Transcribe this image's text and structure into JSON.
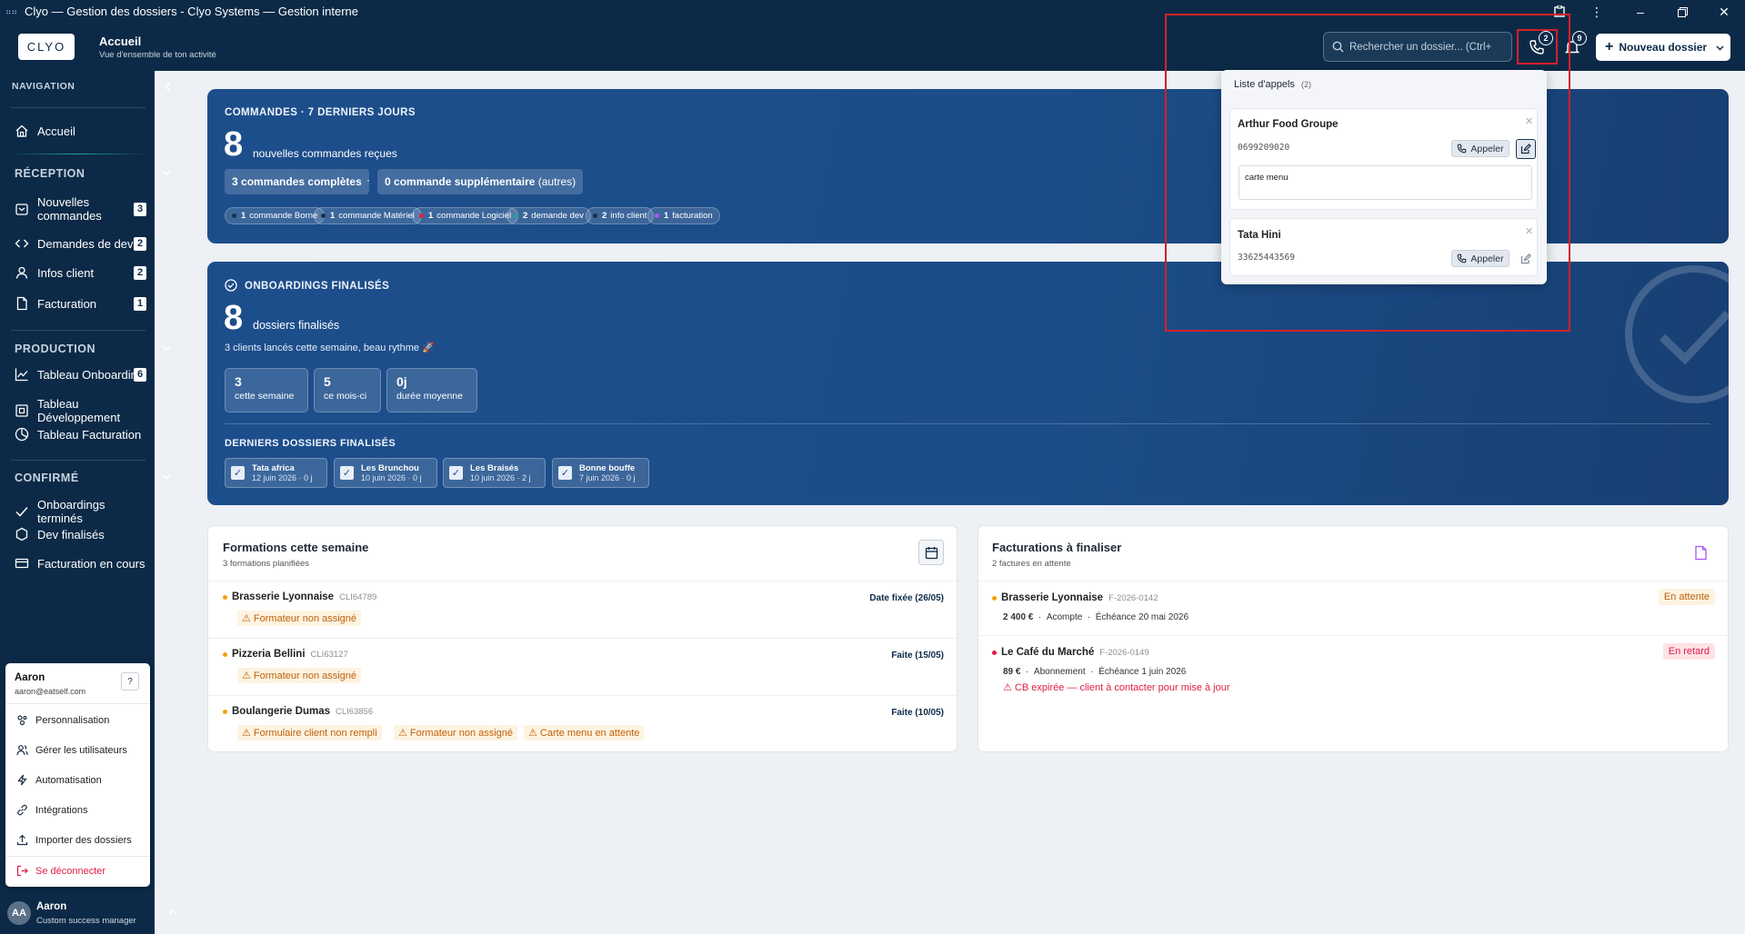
{
  "window": {
    "title": "Clyo — Gestion des dossiers - Clyo Systems — Gestion interne",
    "app_icon": "app-icon"
  },
  "header": {
    "logo": "CLYO",
    "title": "Accueil",
    "subtitle": "Vue d'ensemble de ton activité",
    "search_placeholder": "Rechercher un dossier... (Ctrl+",
    "calls_badge": "2",
    "notif_badge": "9",
    "new_button": "Nouveau dossier"
  },
  "sidebar": {
    "nav_label": "NAVIGATION",
    "home": "Accueil",
    "sections": [
      {
        "title": "RÉCEPTION",
        "items": [
          {
            "label": "Nouvelles commandes",
            "count": "3"
          },
          {
            "label": "Demandes de dev",
            "count": "2"
          },
          {
            "label": "Infos client",
            "count": "2"
          },
          {
            "label": "Facturation",
            "count": "1"
          }
        ]
      },
      {
        "title": "PRODUCTION",
        "items": [
          {
            "label": "Tableau Onboarding",
            "count": "6"
          },
          {
            "label": "Tableau Développement",
            "count": ""
          },
          {
            "label": "Tableau Facturation",
            "count": ""
          }
        ]
      },
      {
        "title": "CONFIRMÉ",
        "items": [
          {
            "label": "Onboardings terminés"
          },
          {
            "label": "Dev finalisés"
          },
          {
            "label": "Facturation en cours"
          }
        ]
      }
    ],
    "user_menu": {
      "name": "Aaron",
      "email": "aaron@eatself.com",
      "help": "?",
      "items": [
        "Personnalisation",
        "Gérer les utilisateurs",
        "Automatisation",
        "Intégrations",
        "Importer des dossiers",
        "Se déconnecter"
      ]
    },
    "user_footer": {
      "initials": "AA",
      "name": "Aaron",
      "role": "Custom success manager"
    }
  },
  "orders_card": {
    "label": "COMMANDES · 7 DERNIERS JOURS",
    "count": "8",
    "count_text": "nouvelles commandes reçues",
    "complete_num": "3",
    "complete_text": "commandes complètes",
    "separator": "·",
    "extra_num": "0",
    "extra_text": "commande supplémentaire",
    "extra_paren": "(autres)",
    "tags": [
      {
        "num": "1",
        "text": "commande Borne",
        "color": "#1c2f44"
      },
      {
        "num": "1",
        "text": "commande Matériel",
        "color": "#1c2f44"
      },
      {
        "num": "1",
        "text": "commande Logiciel",
        "color": "#e11d48"
      },
      {
        "num": "2",
        "text": "demande dev",
        "color": "#1fa6a0"
      },
      {
        "num": "2",
        "text": "info client",
        "color": "#1c2f44"
      },
      {
        "num": "1",
        "text": "facturation",
        "color": "#a855f7"
      }
    ]
  },
  "onboarding_card": {
    "label": "ONBOARDINGS FINALISÉS",
    "count": "8",
    "count_text": "dossiers finalisés",
    "tagline": "3 clients lancés cette semaine, beau rythme 🚀",
    "stats": [
      {
        "value": "3",
        "label": "cette semaine"
      },
      {
        "value": "5",
        "label": "ce mois-ci"
      },
      {
        "value": "0j",
        "label": "durée moyenne"
      }
    ],
    "recent_label": "DERNIERS DOSSIERS FINALISÉS",
    "recent": [
      {
        "name": "Tata africa",
        "meta": "12 juin 2026 · 0 j"
      },
      {
        "name": "Les Brunchou",
        "meta": "10 juin 2026 · 0 j"
      },
      {
        "name": "Les Braisés",
        "meta": "10 juin 2026 · 2 j"
      },
      {
        "name": "Bonne bouffe",
        "meta": "7 juin 2026 · 0 j"
      }
    ]
  },
  "formations": {
    "title": "Formations cette semaine",
    "subtitle": "3 formations planifiées",
    "rows": [
      {
        "name": "Brasserie Lyonnaise",
        "code": "CLI64789",
        "status": "Date fixée (26/05)",
        "warnings": [
          "⚠ Formateur non assigné"
        ]
      },
      {
        "name": "Pizzeria Bellini",
        "code": "CLI63127",
        "status": "Faite (15/05)",
        "warnings": [
          "⚠ Formateur non assigné"
        ]
      },
      {
        "name": "Boulangerie Dumas",
        "code": "CLI63856",
        "status": "Faite (10/05)",
        "warnings": [
          "⚠ Formulaire client non rempli",
          "⚠ Formateur non assigné",
          "⚠ Carte menu en attente"
        ]
      }
    ]
  },
  "facturations": {
    "title": "Facturations à finaliser",
    "subtitle": "2 factures en attente",
    "rows": [
      {
        "name": "Brasserie Lyonnaise",
        "code": "F-2026-0142",
        "amount": "2 400 €",
        "type": "Acompte",
        "due": "Échéance 20 mai 2026",
        "status": "En attente",
        "alert": ""
      },
      {
        "name": "Le Café du Marché",
        "code": "F-2026-0149",
        "amount": "89 €",
        "type": "Abonnement",
        "due": "Échéance 1 juin 2026",
        "status": "En retard",
        "alert": "⚠ CB expirée — client à contacter pour mise à jour"
      }
    ]
  },
  "calls_popup": {
    "title": "Liste d'appels",
    "count": "(2)",
    "calls": [
      {
        "name": "Arthur Food Groupe",
        "phone": "0699209020",
        "action": "Appeler",
        "note": "carte menu"
      },
      {
        "name": "Tata Hini",
        "phone": "33625443569",
        "action": "Appeler"
      }
    ]
  },
  "colors": {
    "navy": "#0c2a47",
    "card_blue": "#1d4e8c",
    "warning": "#c0610a",
    "danger": "#e11d48",
    "annotation": "#d62027"
  }
}
